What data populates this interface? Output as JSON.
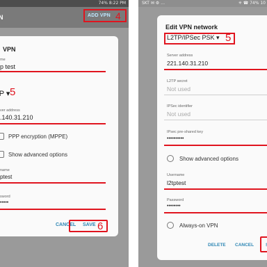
{
  "left": {
    "status_bar": "74% 8:22 PM",
    "appbar_title": "N",
    "add_vpn_label": "ADD VPN",
    "step_add": "4",
    "dialog_title": "VPN",
    "name_label": "me",
    "name_value": "p test",
    "type_value": "TP ▾",
    "step_type": "5",
    "server_label": "ver address",
    "server_value": ".140.31.210",
    "mppe_label": "PPP encryption (MPPE)",
    "advanced_label": "Show advanced options",
    "username_label": "name",
    "username_value": "ptest",
    "password_label": "sword",
    "password_value": "•••••",
    "cancel_label": "CANCEL",
    "save_label": "SAVE",
    "step_save": "6"
  },
  "right": {
    "status_left": "SKT ✉ ⚙ …",
    "status_right": "✳ ☎ 74% 10",
    "dialog_title": "Edit VPN network",
    "type_value": "L2TP/IPSec PSK ▾",
    "step_type": "5",
    "server_label": "Server address",
    "server_value": "221.140.31.210",
    "l2tp_secret_label": "L2TP secret",
    "l2tp_secret_hint": "Not used",
    "ipsec_id_label": "IPSec identifier",
    "ipsec_id_hint": "Not used",
    "psk_label": "IPsec pre-shared key",
    "psk_value": "••••••••••",
    "advanced_label": "Show advanced options",
    "username_label": "Username",
    "username_value": "l2tptest",
    "password_label": "Password",
    "password_value": "••••••••",
    "always_on_label": "Always-on VPN",
    "delete_label": "DELETE",
    "cancel_label": "CANCEL",
    "save_label": "S"
  },
  "colors": {
    "highlight_red": "#e0141e",
    "button_blue": "#2d86b4"
  }
}
